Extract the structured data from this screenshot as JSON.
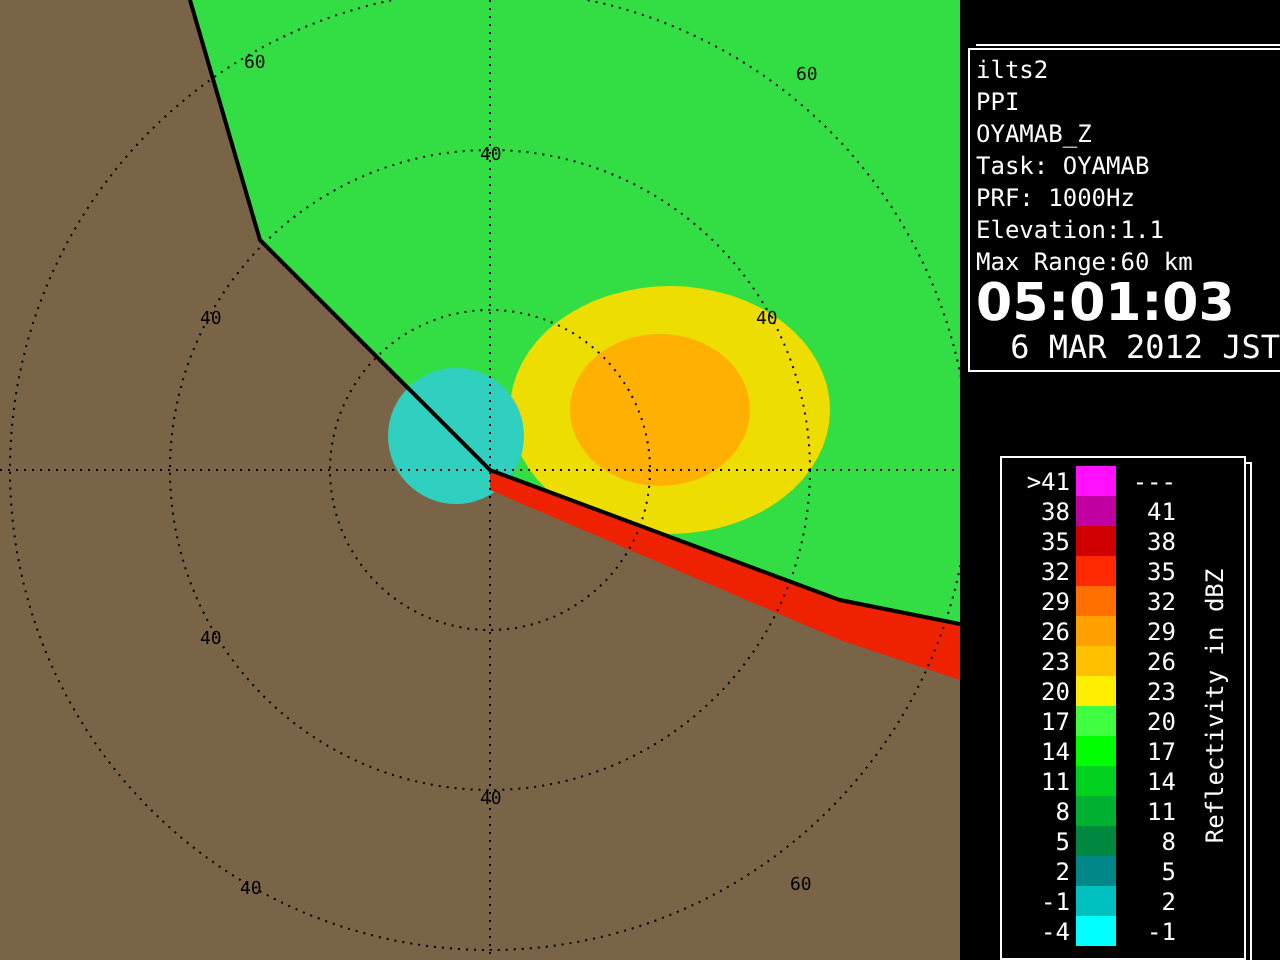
{
  "map": {
    "range_labels": [
      "60",
      "60",
      "40",
      "40",
      "40",
      "40",
      "40",
      "40",
      "60"
    ]
  },
  "info": {
    "lines": [
      "ilts2",
      "PPI",
      "OYAMAB_Z",
      "Task: OYAMAB",
      "PRF: 1000Hz",
      "Elevation:1.1",
      "Max Range:60 km"
    ],
    "time": "05:01:03",
    "date": "6 MAR 2012 JST"
  },
  "legend": {
    "title": "Reflectivity in dBZ",
    "rows": [
      {
        "low": ">41",
        "high": "---",
        "color": "#ff10ff"
      },
      {
        "low": "38",
        "high": "41",
        "color": "#c000a0"
      },
      {
        "low": "35",
        "high": "38",
        "color": "#d00000"
      },
      {
        "low": "32",
        "high": "35",
        "color": "#ff2800"
      },
      {
        "low": "29",
        "high": "32",
        "color": "#ff7000"
      },
      {
        "low": "26",
        "high": "29",
        "color": "#ffa000"
      },
      {
        "low": "23",
        "high": "26",
        "color": "#ffc000"
      },
      {
        "low": "20",
        "high": "23",
        "color": "#ffee00"
      },
      {
        "low": "17",
        "high": "20",
        "color": "#40ff40"
      },
      {
        "low": "14",
        "high": "17",
        "color": "#00ff00"
      },
      {
        "low": "11",
        "high": "14",
        "color": "#00d020"
      },
      {
        "low": "8",
        "high": "11",
        "color": "#00b030"
      },
      {
        "low": "5",
        "high": "8",
        "color": "#008840"
      },
      {
        "low": "2",
        "high": "5",
        "color": "#008888"
      },
      {
        "low": "-1",
        "high": "2",
        "color": "#00c0c0"
      },
      {
        "low": "-4",
        "high": "-1",
        "color": "#00ffff"
      }
    ]
  }
}
